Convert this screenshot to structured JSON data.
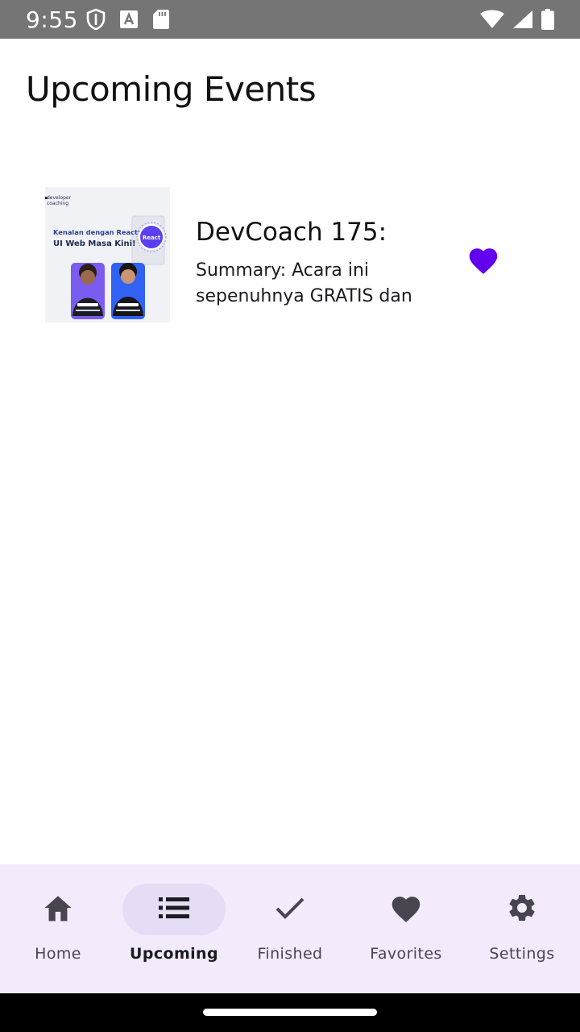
{
  "status_bar": {
    "time": "9:55"
  },
  "page": {
    "title": "Upcoming Events"
  },
  "events": [
    {
      "title": "DevCoach 175:",
      "summary": "Summary: Acara ini sepenuhnya GRATIS dan",
      "favorite": true,
      "thumbnail": {
        "brand_line1": "developer",
        "brand_line2": "coaching",
        "headline_line1": "Kenalan dengan React:",
        "headline_line2": "UI Web Masa Kini!",
        "badge": "React"
      }
    }
  ],
  "bottom_nav": {
    "items": [
      {
        "label": "Home",
        "icon": "home-icon",
        "active": false
      },
      {
        "label": "Upcoming",
        "icon": "list-icon",
        "active": true
      },
      {
        "label": "Finished",
        "icon": "check-icon",
        "active": false
      },
      {
        "label": "Favorites",
        "icon": "heart-icon",
        "active": false
      },
      {
        "label": "Settings",
        "icon": "gear-icon",
        "active": false
      }
    ]
  },
  "colors": {
    "status_bar": "#757575",
    "accent": "#6200ee",
    "nav_background": "#f3eafc",
    "nav_indicator": "#e6dcf5"
  }
}
